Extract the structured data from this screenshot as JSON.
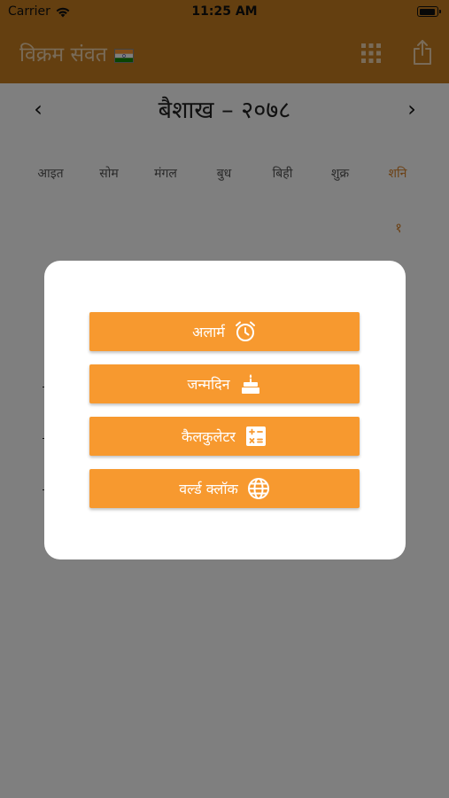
{
  "status_bar": {
    "carrier": "Carrier",
    "time": "11:25 AM"
  },
  "nav": {
    "title": "विक्रम संवत"
  },
  "calendar": {
    "month_year": "बैशाख – २०७८",
    "weekdays": [
      "आइत",
      "सोम",
      "मंगल",
      "बुध",
      "बिही",
      "शुक्र",
      "शनि"
    ],
    "first_day": "१"
  },
  "menu": {
    "items": [
      {
        "label": "अलार्म",
        "icon": "alarm-clock-icon"
      },
      {
        "label": "जन्मदिन",
        "icon": "birthday-cake-icon"
      },
      {
        "label": "कैलकुलेटर",
        "icon": "calculator-icon"
      },
      {
        "label": "वर्ल्ड क्लॉक",
        "icon": "globe-icon"
      }
    ]
  },
  "colors": {
    "accent": "#f7992f",
    "nav_bar": "#c97e20",
    "saturday": "#d9832a"
  }
}
